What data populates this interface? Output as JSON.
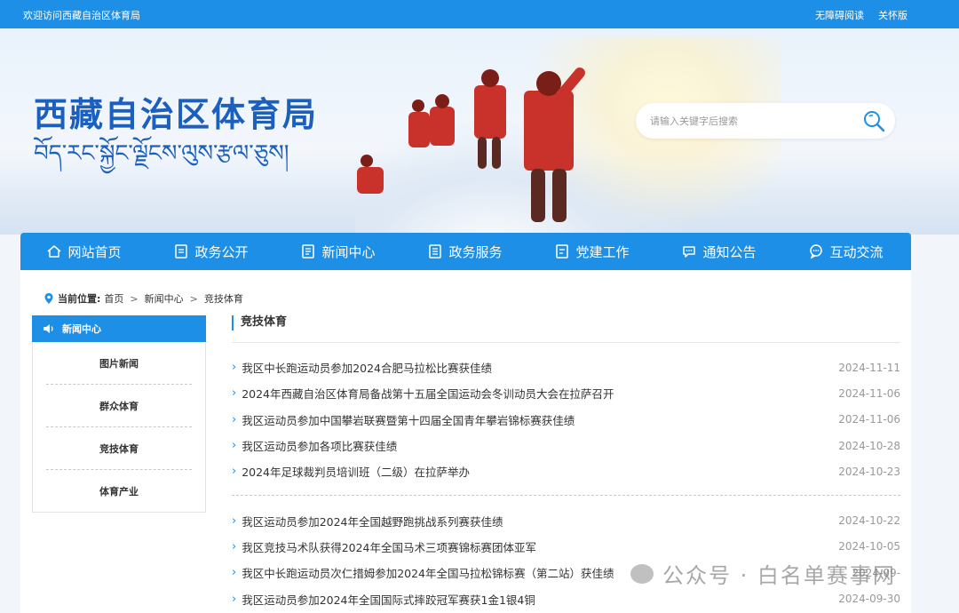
{
  "topbar": {
    "welcome": "欢迎访问西藏自治区体育局",
    "accessible": "无障碍阅读",
    "elderly": "关怀版"
  },
  "banner": {
    "title_cn": "西藏自治区体育局",
    "title_tibetan": "བོད་རང་སྐྱོང་ལྗོངས་ལུས་རྩལ་ཅུས།"
  },
  "search": {
    "placeholder": "请输入关键字后搜索"
  },
  "nav": {
    "items": [
      {
        "label": "网站首页",
        "icon": "home-icon"
      },
      {
        "label": "政务公开",
        "icon": "document-icon"
      },
      {
        "label": "新闻中心",
        "icon": "news-icon"
      },
      {
        "label": "政务服务",
        "icon": "service-icon"
      },
      {
        "label": "党建工作",
        "icon": "party-icon"
      },
      {
        "label": "通知公告",
        "icon": "notice-icon"
      },
      {
        "label": "互动交流",
        "icon": "chat-icon"
      }
    ]
  },
  "breadcrumb": {
    "label": "当前位置:",
    "items": [
      "首页",
      "新闻中心",
      "竞技体育"
    ]
  },
  "sidebar": {
    "title": "新闻中心",
    "items": [
      "图片新闻",
      "群众体育",
      "竞技体育",
      "体育产业"
    ]
  },
  "main": {
    "title": "竞技体育",
    "group1": [
      {
        "title": "我区中长跑运动员参加2024合肥马拉松比赛获佳绩",
        "date": "2024-11-11"
      },
      {
        "title": "2024年西藏自治区体育局备战第十五届全国运动会冬训动员大会在拉萨召开",
        "date": "2024-11-06"
      },
      {
        "title": "我区运动员参加中国攀岩联赛暨第十四届全国青年攀岩锦标赛获佳绩",
        "date": "2024-11-06"
      },
      {
        "title": "我区运动员参加各项比赛获佳绩",
        "date": "2024-10-28"
      },
      {
        "title": "2024年足球裁判员培训班（二级）在拉萨举办",
        "date": "2024-10-23"
      }
    ],
    "group2": [
      {
        "title": "我区运动员参加2024年全国越野跑挑战系列赛获佳绩",
        "date": "2024-10-22"
      },
      {
        "title": "我区竞技马术队获得2024年全国马术三项赛锦标赛团体亚军",
        "date": "2024-10-05"
      },
      {
        "title": "我区中长跑运动员次仁措姆参加2024年全国马拉松锦标赛（第二站）获佳绩",
        "date": "2024-09-"
      },
      {
        "title": "我区运动员参加2024年全国国际式摔跤冠军赛获1金1银4铜",
        "date": "2024-09-30"
      }
    ]
  },
  "watermark": {
    "text": "公众号 · 白名单赛事网"
  },
  "colors": {
    "primary": "#1e8fe6",
    "title": "#1b5fbf"
  }
}
